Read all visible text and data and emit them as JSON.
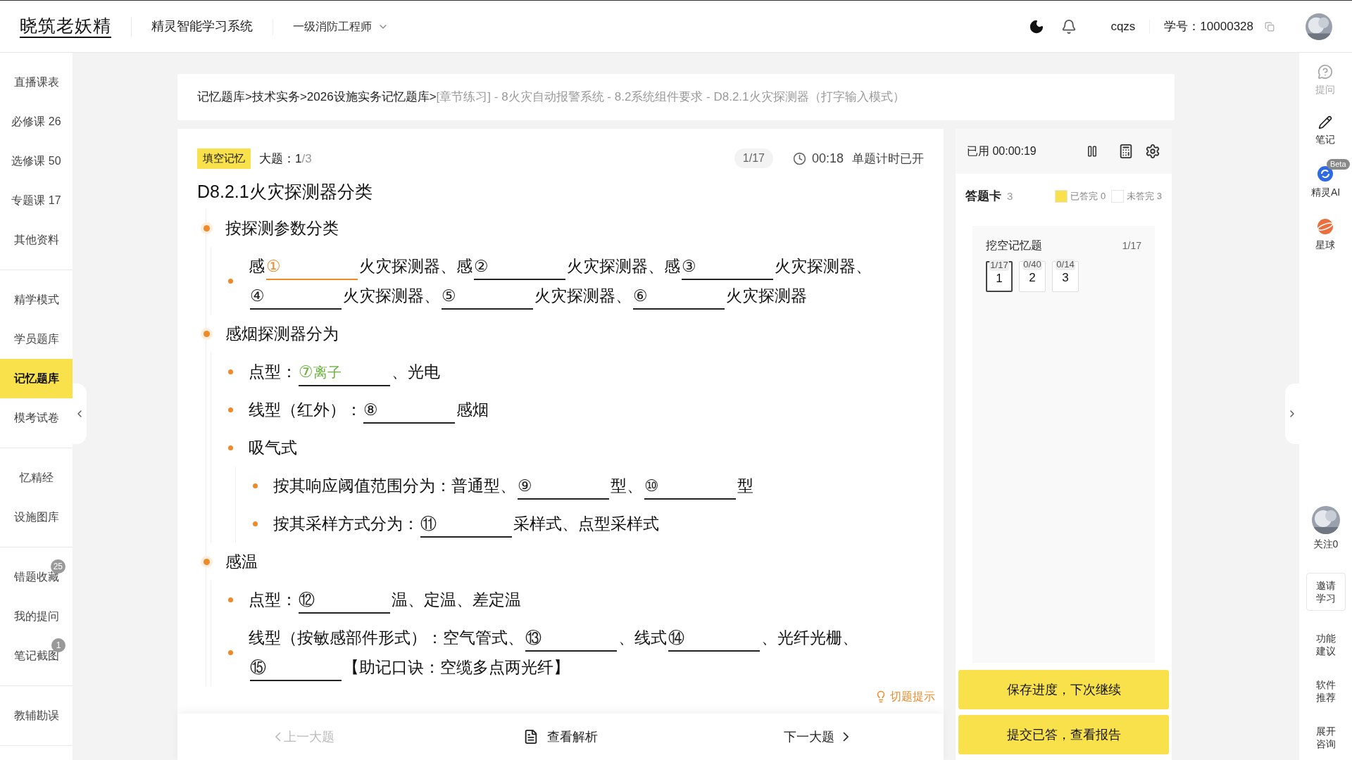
{
  "header": {
    "logo": "晓筑老妖精",
    "system_name": "精灵智能学习系统",
    "course": "一级消防工程师",
    "username": "cqzs",
    "student_id_label": "学号：",
    "student_id": "10000328"
  },
  "sidebar": {
    "groups": [
      {
        "items": [
          {
            "label": "直播课表",
            "selected": false
          },
          {
            "label": "必修课 26",
            "selected": false
          },
          {
            "label": "选修课 50",
            "selected": false
          },
          {
            "label": "专题课 17",
            "selected": false
          },
          {
            "label": "其他资料",
            "selected": false
          }
        ]
      },
      {
        "items": [
          {
            "label": "精学模式",
            "selected": false
          },
          {
            "label": "学员题库",
            "selected": false
          },
          {
            "label": "记忆题库",
            "selected": true
          },
          {
            "label": "模考试卷",
            "selected": false
          }
        ]
      },
      {
        "items": [
          {
            "label": "忆精经",
            "selected": false
          },
          {
            "label": "设施图库",
            "selected": false
          }
        ]
      },
      {
        "items": [
          {
            "label": "错题收藏",
            "selected": false,
            "badge": "25"
          },
          {
            "label": "我的提问",
            "selected": false
          },
          {
            "label": "笔记截图",
            "selected": false,
            "badge": "1"
          }
        ]
      },
      {
        "items": [
          {
            "label": "教辅勘误",
            "selected": false
          }
        ]
      }
    ]
  },
  "breadcrumb": {
    "path": "记忆题库>技术实务>2026设施实务记忆题库>",
    "detail": "[章节练习] - 8火灾自动报警系统 - 8.2系统组件要求 - D8.2.1火灾探测器（打字输入模式）"
  },
  "question": {
    "type_tag": "填空记忆",
    "section_label": "大题：",
    "section_current": "1",
    "section_total": "/3",
    "progress": "1/17",
    "timer": "00:18",
    "timer_note": "单题计时已开",
    "title": "D8.2.1火灾探测器分类",
    "hint": "切题提示",
    "outline": [
      {
        "segments": [
          {
            "kind": "text",
            "text": "按探测参数分类"
          }
        ],
        "children": [
          {
            "segments": [
              {
                "kind": "text",
                "text": "感"
              },
              {
                "kind": "blank",
                "mark": "①",
                "selected": true
              },
              {
                "kind": "text",
                "text": "火灾探测器、感"
              },
              {
                "kind": "blank",
                "mark": "②",
                "selected": false
              },
              {
                "kind": "text",
                "text": "火灾探测器、感"
              },
              {
                "kind": "blank",
                "mark": "③",
                "selected": false
              },
              {
                "kind": "text",
                "text": "火灾探测器、"
              },
              {
                "kind": "blank",
                "mark": "④",
                "selected": false
              },
              {
                "kind": "text",
                "text": "火灾探测器、"
              },
              {
                "kind": "blank",
                "mark": "⑤",
                "selected": false
              },
              {
                "kind": "text",
                "text": "火灾探测器、"
              },
              {
                "kind": "blank",
                "mark": "⑥",
                "selected": false
              },
              {
                "kind": "text",
                "text": "火灾探测器"
              }
            ]
          }
        ]
      },
      {
        "segments": [
          {
            "kind": "text",
            "text": "感烟探测器分为"
          }
        ],
        "children": [
          {
            "segments": [
              {
                "kind": "text",
                "text": "点型："
              },
              {
                "kind": "blank",
                "mark": "⑦",
                "answer": "离子",
                "selected": false
              },
              {
                "kind": "text",
                "text": "、光电"
              }
            ]
          },
          {
            "segments": [
              {
                "kind": "text",
                "text": "线型（红外）："
              },
              {
                "kind": "blank",
                "mark": "⑧",
                "selected": false
              },
              {
                "kind": "text",
                "text": "感烟"
              }
            ]
          },
          {
            "segments": [
              {
                "kind": "text",
                "text": "吸气式"
              }
            ],
            "children": [
              {
                "segments": [
                  {
                    "kind": "text",
                    "text": "按其响应阈值范围分为：普通型、"
                  },
                  {
                    "kind": "blank",
                    "mark": "⑨",
                    "selected": false
                  },
                  {
                    "kind": "text",
                    "text": "型、"
                  },
                  {
                    "kind": "blank",
                    "mark": "⑩",
                    "selected": false
                  },
                  {
                    "kind": "text",
                    "text": "型"
                  }
                ]
              },
              {
                "segments": [
                  {
                    "kind": "text",
                    "text": "按其采样方式分为："
                  },
                  {
                    "kind": "blank",
                    "mark": "⑪",
                    "selected": false
                  },
                  {
                    "kind": "text",
                    "text": "采样式、点型采样式"
                  }
                ]
              }
            ]
          }
        ]
      },
      {
        "segments": [
          {
            "kind": "text",
            "text": "感温"
          }
        ],
        "children": [
          {
            "segments": [
              {
                "kind": "text",
                "text": "点型："
              },
              {
                "kind": "blank",
                "mark": "⑫",
                "selected": false
              },
              {
                "kind": "text",
                "text": "温、定温、差定温"
              }
            ]
          },
          {
            "segments": [
              {
                "kind": "text",
                "text": "线型（按敏感部件形式）：空气管式、"
              },
              {
                "kind": "blank",
                "mark": "⑬",
                "selected": false
              },
              {
                "kind": "text",
                "text": "、线式"
              },
              {
                "kind": "blank",
                "mark": "⑭",
                "selected": false
              },
              {
                "kind": "text",
                "text": "、光纤光栅、"
              },
              {
                "kind": "blank",
                "mark": "⑮",
                "selected": false
              },
              {
                "kind": "text",
                "text": "【助记口诀：空缆多点两光纤】"
              }
            ]
          }
        ]
      }
    ]
  },
  "nav": {
    "prev": {
      "label": "上一大题",
      "disabled": true
    },
    "analysis": "查看解析",
    "next": {
      "label": "下一大题",
      "disabled": false
    }
  },
  "answer_panel": {
    "elapsed": "已用 00:00:19",
    "card_title": "答题卡",
    "card_count": "3",
    "legend": [
      {
        "label": "已答完 0",
        "color": "#f9e14b"
      },
      {
        "label": "未答完 3",
        "color": "#ffffff"
      }
    ],
    "group": {
      "title": "挖空记忆题",
      "progress": "1/17",
      "items": [
        {
          "number": "1",
          "progress": "1/17",
          "selected": true
        },
        {
          "number": "2",
          "progress": "0/40",
          "selected": false
        },
        {
          "number": "3",
          "progress": "0/14",
          "selected": false
        }
      ]
    },
    "buttons": [
      "保存进度，下次继续",
      "提交已答，查看报告"
    ]
  },
  "right_rail": [
    {
      "kind": "question",
      "label": "提问",
      "disabled": true
    },
    {
      "kind": "note",
      "label": "笔记",
      "disabled": false
    },
    {
      "kind": "ai",
      "label": "精灵AI",
      "badge": "Beta",
      "disabled": false
    },
    {
      "kind": "planet",
      "label": "星球",
      "disabled": false
    },
    {
      "kind": "avatar",
      "label": "关注0",
      "disabled": false
    },
    {
      "kind": "boxed",
      "label": "邀请学习",
      "disabled": false
    },
    {
      "kind": "text",
      "label": "功能建议",
      "disabled": false
    },
    {
      "kind": "text",
      "label": "软件推荐",
      "disabled": false
    },
    {
      "kind": "text",
      "label": "展开咨询",
      "disabled": false
    }
  ]
}
